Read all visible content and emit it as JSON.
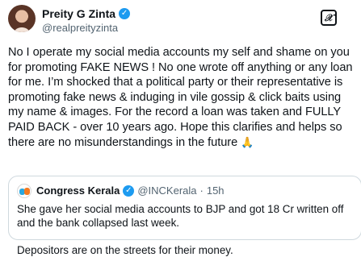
{
  "author": {
    "display_name": "Preity G Zinta",
    "handle": "@realpreityzinta",
    "verified_mark": "✓"
  },
  "grok_label": "𝒳",
  "tweet": {
    "text": "No I operate my social media accounts my self and shame on you for promoting FAKE NEWS ! No one wrote off anything or any loan for me. I’m shocked that a political party or their representative is promoting fake news & induging in vile gossip & click baits using my name & images. For the record a loan was taken and FULLY PAID BACK - over 10 years ago. Hope this clarifies and helps so there are no misunderstandings in the future",
    "emoji": "🙏"
  },
  "quote": {
    "display_name": "Congress Kerala",
    "verified_mark": "✓",
    "handle": "@INCKerala",
    "separator": "·",
    "time": "15h",
    "line1": "She gave her social media accounts to BJP and got 18 Cr written off and the bank collapsed last week.",
    "line2": "Depositors are on the streets for their money."
  },
  "colors": {
    "verified_blue": "#1d9bf0",
    "muted_text": "#536471",
    "border": "#cfd9de"
  },
  "icons": [
    "verified-icon",
    "grok-icon",
    "more-icon",
    "pray-emoji"
  ]
}
